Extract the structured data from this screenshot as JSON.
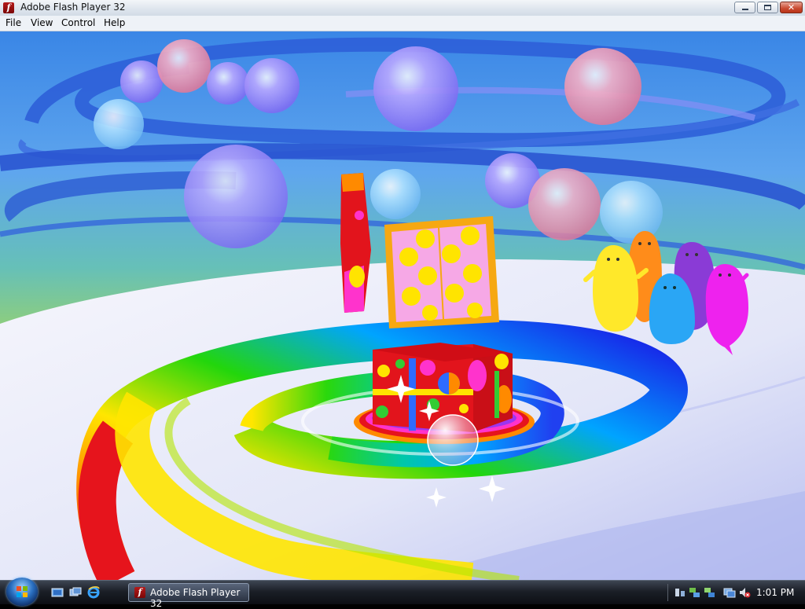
{
  "window": {
    "title": "Adobe Flash Player 32"
  },
  "menu": {
    "items": [
      "File",
      "View",
      "Control",
      "Help"
    ]
  },
  "taskbar": {
    "task_label": "Adobe Flash Player 32",
    "clock": "1:01 PM"
  },
  "colors": {
    "sky": "#3a8ee8",
    "floor": "#e6e9f7",
    "box_red": "#e2141c",
    "polka": "#ffe400",
    "frame_orange": "#f6a812"
  },
  "icons": [
    "flash-icon",
    "minimize-icon",
    "maximize-icon",
    "close-icon",
    "windows-start-icon",
    "show-desktop-icon",
    "switch-windows-icon",
    "internet-explorer-icon",
    "network-icon",
    "volume-muted-icon"
  ]
}
